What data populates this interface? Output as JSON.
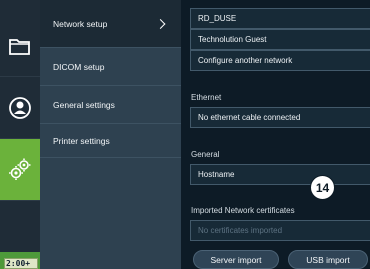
{
  "menu": {
    "items": [
      {
        "label": "Network setup"
      },
      {
        "label": "DICOM setup"
      },
      {
        "label": "General settings"
      },
      {
        "label": "Printer settings"
      }
    ]
  },
  "status": {
    "timer": "2:00+"
  },
  "wifi": {
    "networks": [
      "RD_DUSE",
      "Technolution Guest"
    ],
    "configure_label": "Configure another network"
  },
  "ethernet": {
    "label": "Ethernet",
    "status": "No ethernet cable connected"
  },
  "general": {
    "label": "General",
    "hostname_label": "Hostname"
  },
  "certificates": {
    "label": "Imported Network certificates",
    "empty": "No certificates imported"
  },
  "callout": {
    "number": "14"
  },
  "buttons": {
    "server_import": "Server import",
    "usb_import": "USB import"
  }
}
